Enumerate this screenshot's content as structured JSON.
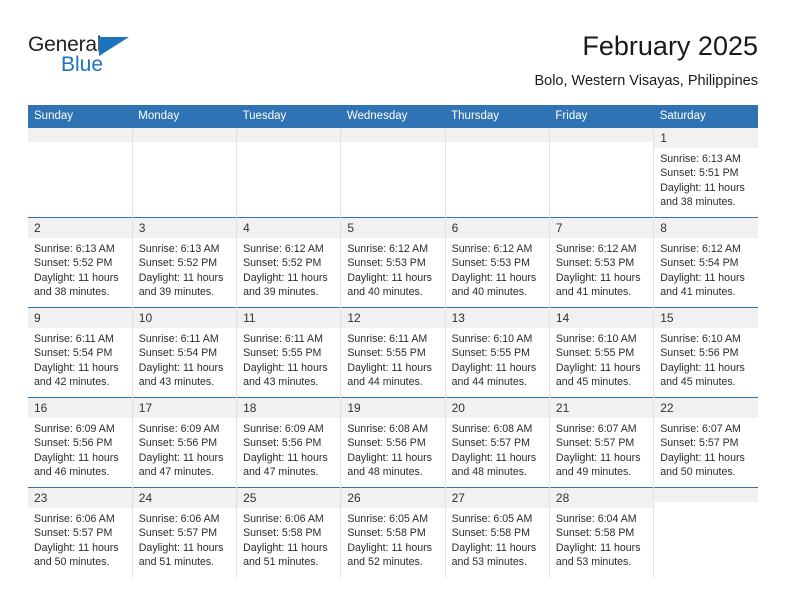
{
  "brand": {
    "name_top": "General",
    "name_bottom": "Blue",
    "accent_color": "#1f72bc"
  },
  "header": {
    "title": "February 2025",
    "subtitle": "Bolo, Western Visayas, Philippines"
  },
  "theme": {
    "header_blue": "#3073b4",
    "daynum_bg": "#f1f1f1",
    "text": "#2b2b2b"
  },
  "weekday_headers": [
    "Sunday",
    "Monday",
    "Tuesday",
    "Wednesday",
    "Thursday",
    "Friday",
    "Saturday"
  ],
  "weeks": [
    [
      {
        "day": "",
        "empty": true,
        "sunrise": "",
        "sunset": "",
        "daylight_line1": "",
        "daylight_line2": ""
      },
      {
        "day": "",
        "empty": true,
        "sunrise": "",
        "sunset": "",
        "daylight_line1": "",
        "daylight_line2": ""
      },
      {
        "day": "",
        "empty": true,
        "sunrise": "",
        "sunset": "",
        "daylight_line1": "",
        "daylight_line2": ""
      },
      {
        "day": "",
        "empty": true,
        "sunrise": "",
        "sunset": "",
        "daylight_line1": "",
        "daylight_line2": ""
      },
      {
        "day": "",
        "empty": true,
        "sunrise": "",
        "sunset": "",
        "daylight_line1": "",
        "daylight_line2": ""
      },
      {
        "day": "",
        "empty": true,
        "sunrise": "",
        "sunset": "",
        "daylight_line1": "",
        "daylight_line2": ""
      },
      {
        "day": "1",
        "empty": false,
        "sunrise": "Sunrise: 6:13 AM",
        "sunset": "Sunset: 5:51 PM",
        "daylight_line1": "Daylight: 11 hours",
        "daylight_line2": "and 38 minutes."
      }
    ],
    [
      {
        "day": "2",
        "empty": false,
        "sunrise": "Sunrise: 6:13 AM",
        "sunset": "Sunset: 5:52 PM",
        "daylight_line1": "Daylight: 11 hours",
        "daylight_line2": "and 38 minutes."
      },
      {
        "day": "3",
        "empty": false,
        "sunrise": "Sunrise: 6:13 AM",
        "sunset": "Sunset: 5:52 PM",
        "daylight_line1": "Daylight: 11 hours",
        "daylight_line2": "and 39 minutes."
      },
      {
        "day": "4",
        "empty": false,
        "sunrise": "Sunrise: 6:12 AM",
        "sunset": "Sunset: 5:52 PM",
        "daylight_line1": "Daylight: 11 hours",
        "daylight_line2": "and 39 minutes."
      },
      {
        "day": "5",
        "empty": false,
        "sunrise": "Sunrise: 6:12 AM",
        "sunset": "Sunset: 5:53 PM",
        "daylight_line1": "Daylight: 11 hours",
        "daylight_line2": "and 40 minutes."
      },
      {
        "day": "6",
        "empty": false,
        "sunrise": "Sunrise: 6:12 AM",
        "sunset": "Sunset: 5:53 PM",
        "daylight_line1": "Daylight: 11 hours",
        "daylight_line2": "and 40 minutes."
      },
      {
        "day": "7",
        "empty": false,
        "sunrise": "Sunrise: 6:12 AM",
        "sunset": "Sunset: 5:53 PM",
        "daylight_line1": "Daylight: 11 hours",
        "daylight_line2": "and 41 minutes."
      },
      {
        "day": "8",
        "empty": false,
        "sunrise": "Sunrise: 6:12 AM",
        "sunset": "Sunset: 5:54 PM",
        "daylight_line1": "Daylight: 11 hours",
        "daylight_line2": "and 41 minutes."
      }
    ],
    [
      {
        "day": "9",
        "empty": false,
        "sunrise": "Sunrise: 6:11 AM",
        "sunset": "Sunset: 5:54 PM",
        "daylight_line1": "Daylight: 11 hours",
        "daylight_line2": "and 42 minutes."
      },
      {
        "day": "10",
        "empty": false,
        "sunrise": "Sunrise: 6:11 AM",
        "sunset": "Sunset: 5:54 PM",
        "daylight_line1": "Daylight: 11 hours",
        "daylight_line2": "and 43 minutes."
      },
      {
        "day": "11",
        "empty": false,
        "sunrise": "Sunrise: 6:11 AM",
        "sunset": "Sunset: 5:55 PM",
        "daylight_line1": "Daylight: 11 hours",
        "daylight_line2": "and 43 minutes."
      },
      {
        "day": "12",
        "empty": false,
        "sunrise": "Sunrise: 6:11 AM",
        "sunset": "Sunset: 5:55 PM",
        "daylight_line1": "Daylight: 11 hours",
        "daylight_line2": "and 44 minutes."
      },
      {
        "day": "13",
        "empty": false,
        "sunrise": "Sunrise: 6:10 AM",
        "sunset": "Sunset: 5:55 PM",
        "daylight_line1": "Daylight: 11 hours",
        "daylight_line2": "and 44 minutes."
      },
      {
        "day": "14",
        "empty": false,
        "sunrise": "Sunrise: 6:10 AM",
        "sunset": "Sunset: 5:55 PM",
        "daylight_line1": "Daylight: 11 hours",
        "daylight_line2": "and 45 minutes."
      },
      {
        "day": "15",
        "empty": false,
        "sunrise": "Sunrise: 6:10 AM",
        "sunset": "Sunset: 5:56 PM",
        "daylight_line1": "Daylight: 11 hours",
        "daylight_line2": "and 45 minutes."
      }
    ],
    [
      {
        "day": "16",
        "empty": false,
        "sunrise": "Sunrise: 6:09 AM",
        "sunset": "Sunset: 5:56 PM",
        "daylight_line1": "Daylight: 11 hours",
        "daylight_line2": "and 46 minutes."
      },
      {
        "day": "17",
        "empty": false,
        "sunrise": "Sunrise: 6:09 AM",
        "sunset": "Sunset: 5:56 PM",
        "daylight_line1": "Daylight: 11 hours",
        "daylight_line2": "and 47 minutes."
      },
      {
        "day": "18",
        "empty": false,
        "sunrise": "Sunrise: 6:09 AM",
        "sunset": "Sunset: 5:56 PM",
        "daylight_line1": "Daylight: 11 hours",
        "daylight_line2": "and 47 minutes."
      },
      {
        "day": "19",
        "empty": false,
        "sunrise": "Sunrise: 6:08 AM",
        "sunset": "Sunset: 5:56 PM",
        "daylight_line1": "Daylight: 11 hours",
        "daylight_line2": "and 48 minutes."
      },
      {
        "day": "20",
        "empty": false,
        "sunrise": "Sunrise: 6:08 AM",
        "sunset": "Sunset: 5:57 PM",
        "daylight_line1": "Daylight: 11 hours",
        "daylight_line2": "and 48 minutes."
      },
      {
        "day": "21",
        "empty": false,
        "sunrise": "Sunrise: 6:07 AM",
        "sunset": "Sunset: 5:57 PM",
        "daylight_line1": "Daylight: 11 hours",
        "daylight_line2": "and 49 minutes."
      },
      {
        "day": "22",
        "empty": false,
        "sunrise": "Sunrise: 6:07 AM",
        "sunset": "Sunset: 5:57 PM",
        "daylight_line1": "Daylight: 11 hours",
        "daylight_line2": "and 50 minutes."
      }
    ],
    [
      {
        "day": "23",
        "empty": false,
        "sunrise": "Sunrise: 6:06 AM",
        "sunset": "Sunset: 5:57 PM",
        "daylight_line1": "Daylight: 11 hours",
        "daylight_line2": "and 50 minutes."
      },
      {
        "day": "24",
        "empty": false,
        "sunrise": "Sunrise: 6:06 AM",
        "sunset": "Sunset: 5:57 PM",
        "daylight_line1": "Daylight: 11 hours",
        "daylight_line2": "and 51 minutes."
      },
      {
        "day": "25",
        "empty": false,
        "sunrise": "Sunrise: 6:06 AM",
        "sunset": "Sunset: 5:58 PM",
        "daylight_line1": "Daylight: 11 hours",
        "daylight_line2": "and 51 minutes."
      },
      {
        "day": "26",
        "empty": false,
        "sunrise": "Sunrise: 6:05 AM",
        "sunset": "Sunset: 5:58 PM",
        "daylight_line1": "Daylight: 11 hours",
        "daylight_line2": "and 52 minutes."
      },
      {
        "day": "27",
        "empty": false,
        "sunrise": "Sunrise: 6:05 AM",
        "sunset": "Sunset: 5:58 PM",
        "daylight_line1": "Daylight: 11 hours",
        "daylight_line2": "and 53 minutes."
      },
      {
        "day": "28",
        "empty": false,
        "sunrise": "Sunrise: 6:04 AM",
        "sunset": "Sunset: 5:58 PM",
        "daylight_line1": "Daylight: 11 hours",
        "daylight_line2": "and 53 minutes."
      },
      {
        "day": "",
        "empty": true,
        "sunrise": "",
        "sunset": "",
        "daylight_line1": "",
        "daylight_line2": ""
      }
    ]
  ]
}
